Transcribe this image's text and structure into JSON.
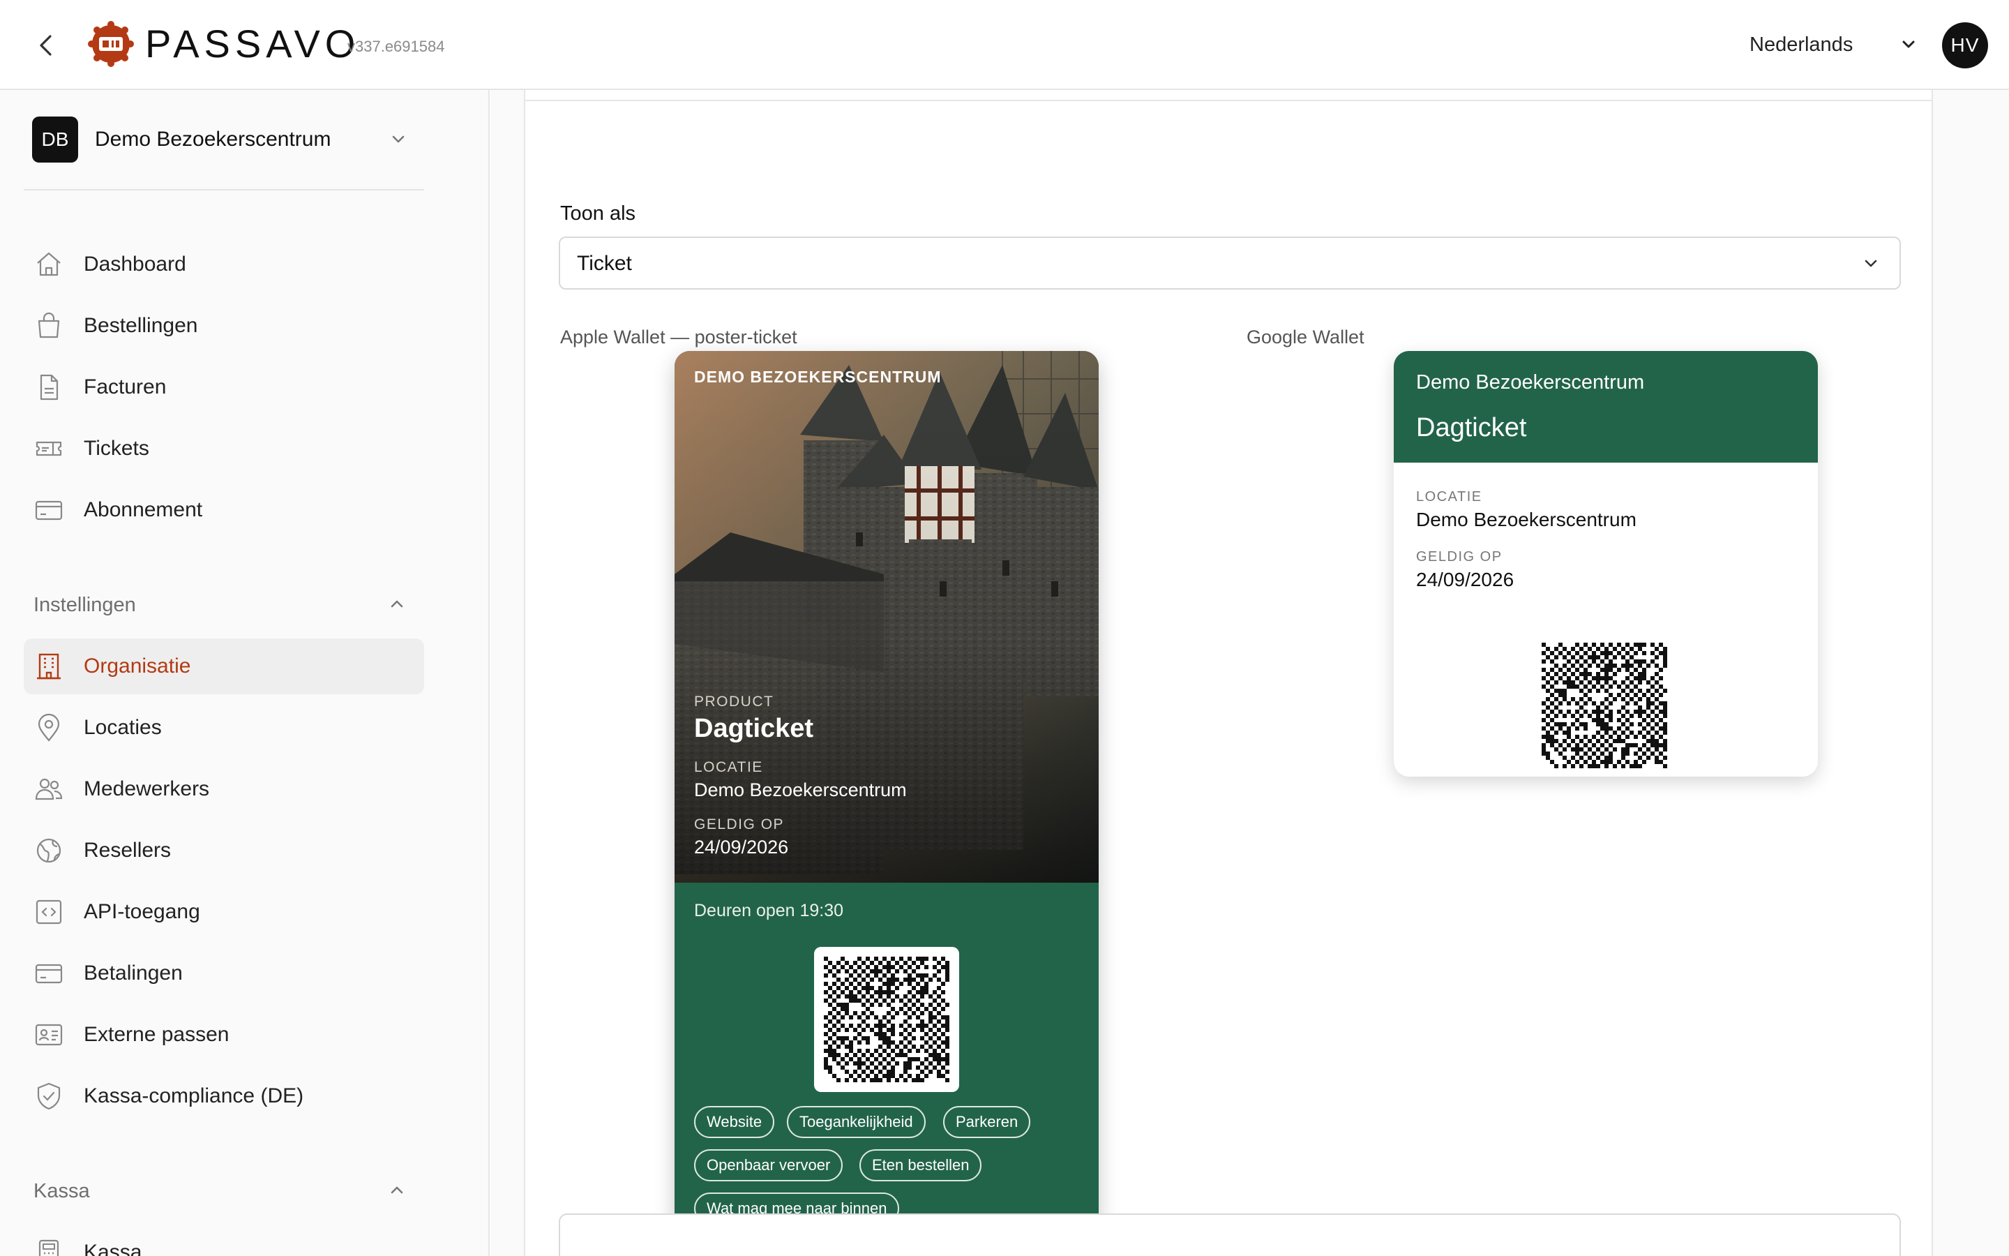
{
  "header": {
    "brand": "PASSAVO",
    "version": "v337.e691584",
    "language": "Nederlands",
    "avatar_initials": "HV",
    "brand_color": "#b33a14"
  },
  "sidebar": {
    "org_initials": "DB",
    "org_name": "Demo Bezoekerscentrum",
    "primary_items": [
      {
        "label": "Dashboard",
        "icon": "home-icon"
      },
      {
        "label": "Bestellingen",
        "icon": "shopping-bag-icon"
      },
      {
        "label": "Facturen",
        "icon": "document-icon"
      },
      {
        "label": "Tickets",
        "icon": "ticket-icon"
      },
      {
        "label": "Abonnement",
        "icon": "credit-card-icon"
      }
    ],
    "settings_section": "Instellingen",
    "settings_items": [
      {
        "label": "Organisatie",
        "icon": "building-icon",
        "active": true
      },
      {
        "label": "Locaties",
        "icon": "map-pin-icon"
      },
      {
        "label": "Medewerkers",
        "icon": "users-icon"
      },
      {
        "label": "Resellers",
        "icon": "globe-icon"
      },
      {
        "label": "API-toegang",
        "icon": "code-icon"
      },
      {
        "label": "Betalingen",
        "icon": "credit-card-icon"
      },
      {
        "label": "Externe passen",
        "icon": "id-card-icon"
      },
      {
        "label": "Kassa-compliance (DE)",
        "icon": "shield-check-icon"
      }
    ],
    "kassa_section": "Kassa",
    "kassa_items": [
      {
        "label": "Kassa",
        "icon": "calculator-icon"
      }
    ]
  },
  "main": {
    "display_label": "Toon als",
    "display_value": "Ticket",
    "apple_label": "Apple Wallet — poster-ticket",
    "google_label": "Google Wallet",
    "apple_pass": {
      "org": "DEMO BEZOEKERSCENTRUM",
      "product_label": "PRODUCT",
      "product": "Dagticket",
      "location_label": "LOCATIE",
      "location": "Demo Bezoekerscentrum",
      "valid_label": "GELDIG OP",
      "valid": "24/09/2026",
      "doors": "Deuren open 19:30",
      "links": [
        "Website",
        "Toegankelijkheid",
        "Parkeren",
        "Openbaar vervoer",
        "Eten bestellen",
        "Wat mag mee naar binnen"
      ]
    },
    "google_pass": {
      "org": "Demo Bezoekerscentrum",
      "title": "Dagticket",
      "location_label": "LOCATIE",
      "location": "Demo Bezoekerscentrum",
      "valid_label": "GELDIG OP",
      "valid": "24/09/2026"
    },
    "pass_color": "#22644a"
  }
}
